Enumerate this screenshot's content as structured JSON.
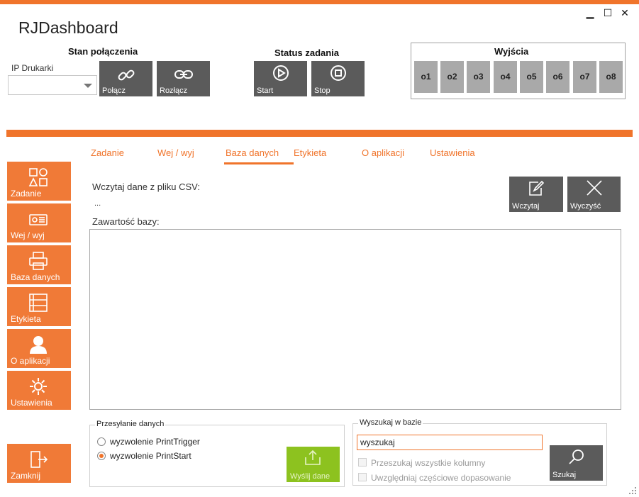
{
  "window": {
    "title": "RJDashboard",
    "minimize_glyph": "▁",
    "maximize_glyph": "☐",
    "close_glyph": "✕"
  },
  "connection": {
    "section_title": "Stan połączenia",
    "printer_ip_label": "IP Drukarki",
    "printer_ip_value": "",
    "connect_label": "Połącz",
    "disconnect_label": "Rozłącz"
  },
  "task_status": {
    "section_title": "Status zadania",
    "start_label": "Start",
    "stop_label": "Stop"
  },
  "outputs": {
    "section_title": "Wyjścia",
    "items": [
      "o1",
      "o2",
      "o3",
      "o4",
      "o5",
      "o6",
      "o7",
      "o8"
    ]
  },
  "tabs": [
    {
      "label": "Zadanie",
      "active": false
    },
    {
      "label": "Wej / wyj",
      "active": false
    },
    {
      "label": "Baza danych",
      "active": true
    },
    {
      "label": "Etykieta",
      "active": false
    },
    {
      "label": "O aplikacji",
      "active": false
    },
    {
      "label": "Ustawienia",
      "active": false
    }
  ],
  "sidebar": {
    "items": [
      {
        "label": "Zadanie",
        "icon": "task-grid-icon"
      },
      {
        "label": "Wej / wyj",
        "icon": "io-card-icon"
      },
      {
        "label": "Baza danych",
        "icon": "printer-icon"
      },
      {
        "label": "Etykieta",
        "icon": "label-list-icon"
      },
      {
        "label": "O aplikacji",
        "icon": "user-icon"
      },
      {
        "label": "Ustawienia",
        "icon": "settings-icon"
      }
    ],
    "close_label": "Zamknij"
  },
  "database": {
    "load_csv_label": "Wczytaj dane z pliku CSV:",
    "file_path": "...",
    "content_label": "Zawartość bazy:",
    "load_button": "Wczytaj",
    "clear_button": "Wyczyść"
  },
  "send": {
    "group_title": "Przesyłanie danych",
    "options": [
      {
        "label": "wyzwolenie PrintTrigger",
        "selected": false
      },
      {
        "label": "wyzwolenie PrintStart",
        "selected": true
      }
    ],
    "send_button": "Wyślij dane"
  },
  "search": {
    "group_title": "Wyszukaj w bazie",
    "query": "wyszukaj",
    "opt_all_columns": "Przeszukaj wszystkie kolumny",
    "opt_partial": "Uwzględniaj częściowe dopasowanie",
    "search_button": "Szukaj"
  },
  "colors": {
    "accent": "#f0742b",
    "dark_button": "#5b5b5b",
    "send_green": "#8dc21f",
    "output_gray": "#a9a9a9"
  }
}
